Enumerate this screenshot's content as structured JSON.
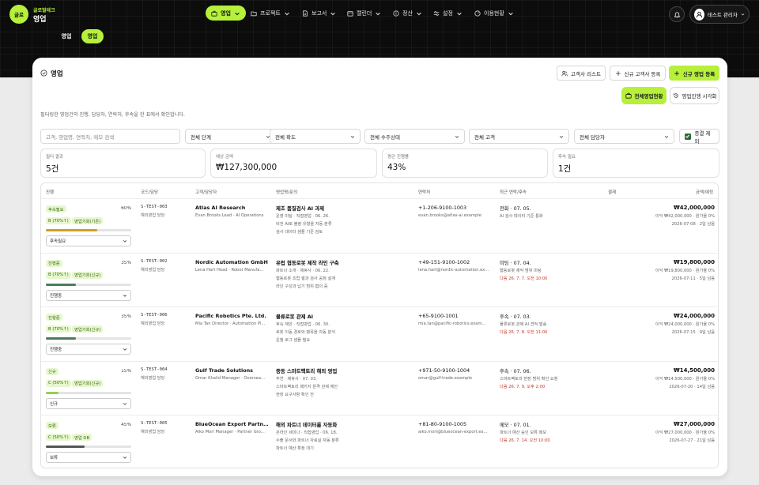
{
  "header": {
    "logo_text": "글로",
    "brand_sub": "글로벌테크",
    "brand_title": "영업",
    "nav": [
      {
        "label": "영업",
        "icon": "briefcase-icon",
        "active": true
      },
      {
        "label": "프로젝트",
        "icon": "folder-icon"
      },
      {
        "label": "보고서",
        "icon": "document-icon"
      },
      {
        "label": "캘린더",
        "icon": "calendar-icon"
      },
      {
        "label": "정산",
        "icon": "coin-icon"
      },
      {
        "label": "설정",
        "icon": "sliders-icon"
      },
      {
        "label": "이용현황",
        "icon": "gauge-icon"
      }
    ],
    "user_name": "테스트 관리자"
  },
  "subtabs": [
    {
      "label": "영업"
    },
    {
      "label": "영업",
      "active": true
    }
  ],
  "page": {
    "title": "영업",
    "description": "필터링한 영업건의 진행, 담당자, 연락처, 후속을 한 표에서 확인합니다.",
    "buttons": {
      "customer_list": "고객사 리스트",
      "new_customer": "신규 고객사 등록",
      "new_sales": "신규 영업 등록",
      "all_status": "전체영업현황",
      "timeline": "영업진행 시각화"
    }
  },
  "filters": {
    "search_placeholder": "고객, 영업명, 연락처, 메모 검색",
    "stage": "전체 단계",
    "probability": "전체 확도",
    "order_status": "전체 수주상태",
    "customer": "전체 고객",
    "owner": "전체 담당자",
    "exclude_closed": "종결 제외"
  },
  "stats": [
    {
      "label": "필터 결과",
      "value": "5건"
    },
    {
      "label": "예상 금액",
      "value": "₩127,300,000"
    },
    {
      "label": "평균 진행률",
      "value": "43%"
    },
    {
      "label": "후속 필요",
      "value": "1건"
    }
  ],
  "table": {
    "columns": [
      "진행",
      "코드/담당",
      "고객/담당자",
      "영업명/문의",
      "연락처",
      "최근 연락/후속",
      "결재",
      "금액/예정"
    ],
    "rows": [
      {
        "status": "후속필요",
        "percent": "60%",
        "progress": 60,
        "bar_color": "#c9a227",
        "tags": [
          "B (70%↑)",
          "영업기회(기존)"
        ],
        "select": "후속필요",
        "code": "S-TEST-003",
        "owner": "해외영업 담당",
        "company": "Atlas AI Research",
        "contact_person": "Evan Brooks Lead · AI Operations",
        "deal": "제조 품질검사 AI 과제",
        "notes": [
          "운영 미팅 · 직접영업 · 06. 26.",
          "비전 AI로 불량 유형을 자동 분류",
          "검사 데이터 샘플 기준 검토"
        ],
        "phone": "+1-206-9100-1003",
        "email": "evan.brooks@atlas-ai.example",
        "recent": "전화 · 07. 05.",
        "recent_note": "AI 검사 데이터 기준 통화",
        "followup": "",
        "amount": "₩42,000,000",
        "amount_sub": "이익 ₩42,000,000 · 원가율 0%",
        "due": "2026-07-08 · 2일 남음"
      },
      {
        "status": "진행중",
        "percent": "35%",
        "progress": 35,
        "bar_color": "#4a7c59",
        "tags": [
          "B (70%↑)",
          "영업기회(신규)"
        ],
        "select": "진행중",
        "code": "S-TEST-002",
        "owner": "해외영업 담당",
        "company": "Nordic Automation GmbH",
        "contact_person": "Lena Hart Head · Robot Manufa...",
        "deal": "유럽 협동로봇 제작 라인 구축",
        "notes": [
          "파트너 소개 · 제휴사 · 06. 22.",
          "협동로봇 조립 셀과 검사 공정 설계",
          "라인 구성과 납기 범위 협의 중"
        ],
        "phone": "+49-151-9100-1002",
        "email": "lena.hart@nordic-automation.ex...",
        "recent": "미팅 · 07. 04.",
        "recent_note": "협동로봇 제작 범위 미팅",
        "followup": "다음 26. 7. 7. 오전 10:00",
        "amount": "₩19,800,000",
        "amount_sub": "이익 ₩19,800,000 · 원가율 0%",
        "due": "2026-07-11 · 5일 남음"
      },
      {
        "status": "진행중",
        "percent": "35%",
        "progress": 35,
        "bar_color": "#4a7c59",
        "tags": [
          "B (70%↑)",
          "영업기회(신규)"
        ],
        "select": "진행중",
        "code": "S-TEST-006",
        "owner": "해외영업 담당",
        "company": "Pacific Robotics Pte. Ltd.",
        "contact_person": "Mia Tan Director · Automation Pl...",
        "deal": "물류로봇 관제 AI",
        "notes": [
          "후속 제안 · 직접영업 · 06. 30.",
          "로봇 이동 경로와 병목을 자동 분석",
          "운행 로그 샘플 필요"
        ],
        "phone": "+65-9100-1001",
        "email": "mia.tan@pacific-robotics.exam...",
        "recent": "후속 · 07. 03.",
        "recent_note": "물류로봇 관제 AI 견적 발송",
        "followup": "다음 26. 7. 8. 오전 11:00",
        "amount": "₩24,000,000",
        "amount_sub": "이익 ₩24,000,000 · 원가율 0%",
        "due": "2026-07-15 · 9일 남음"
      },
      {
        "status": "신규",
        "percent": "15%",
        "progress": 15,
        "bar_color": "#8fd14f",
        "tags": [
          "C (50%↑)",
          "영업기회(신규)"
        ],
        "select": "신규",
        "code": "S-TEST-004",
        "owner": "해외영업 담당",
        "company": "Gulf Trade Solutions",
        "contact_person": "Omar Khalid Manager · Oversea...",
        "deal": "중동 스마트팩토리 해외 영업",
        "notes": [
          "추천 · 제휴사 · 07. 03.",
          "스마트팩토리 패키지 원격 관제 제안",
          "현장 요구사항 확인 전"
        ],
        "phone": "+971-50-9100-1004",
        "email": "omar@gulf-trade.example",
        "recent": "후속 · 07. 06.",
        "recent_note": "스마트팩토리 현장 범위 확인 요청",
        "followup": "다음 26. 7. 9. 오후 2:00",
        "amount": "₩14,500,000",
        "amount_sub": "이익 ₩14,500,000 · 원가율 0%",
        "due": "2026-07-20 · 14일 남음"
      },
      {
        "status": "보류",
        "percent": "45%",
        "progress": 45,
        "bar_color": "#555555",
        "tags": [
          "C (50%↑)",
          "영업 DB"
        ],
        "select": "보류",
        "code": "S-TEST-005",
        "owner": "해외영업 담당",
        "company": "BlueOcean Export Partne...",
        "contact_person": "Aiko Mori Manager · Partner Gro...",
        "deal": "해외 파트너 데이터룸 자동화",
        "notes": [
          "온라인 세미나 · 직접영업 · 06. 18.",
          "수출 문서와 파트너 자료실 자동 분류",
          "파트너 예산 확정 대기"
        ],
        "phone": "+81-80-9100-1005",
        "email": "aiko.mori@blueocean-export.ex...",
        "recent": "메모 · 07. 01.",
        "recent_note": "파트너 예산 승인 보류 메모",
        "followup": "다음 26. 7. 14. 오전 10:00",
        "amount": "₩27,000,000",
        "amount_sub": "이익 ₩27,000,000 · 원가율 0%",
        "due": "2026-07-27 · 21일 남음"
      }
    ]
  },
  "colors": {
    "accent": "#b6f03a",
    "topbar": "#0c0c0d",
    "followup": "#c0392b"
  }
}
